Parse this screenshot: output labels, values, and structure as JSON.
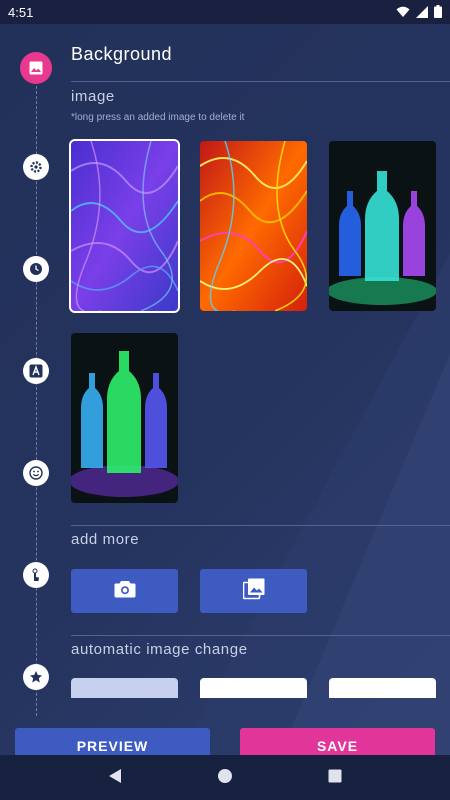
{
  "status": {
    "time": "4:51"
  },
  "header": {
    "title": "Background"
  },
  "image_section": {
    "label": "image",
    "hint": "*long press an added image to delete it"
  },
  "add_more": {
    "label": "add more"
  },
  "auto_change": {
    "label": "automatic image change"
  },
  "actions": {
    "preview_label": "PREVIEW",
    "save_label": "SAVE"
  },
  "timeline_icons": [
    "image-icon",
    "gear-icon",
    "clock-icon",
    "font-icon",
    "smiley-icon",
    "touch-icon",
    "star-icon"
  ],
  "colors": {
    "accent_pink": "#e2359a",
    "accent_blue": "#3e5bc2",
    "background": "#223159"
  }
}
